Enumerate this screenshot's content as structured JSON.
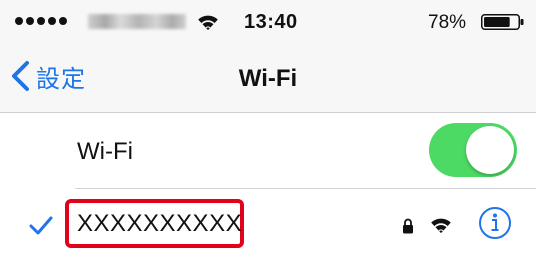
{
  "status_bar": {
    "time": "13:40",
    "battery_percent": "78%",
    "battery_level": 0.78,
    "signal_bars": 5
  },
  "nav": {
    "back_label": "設定",
    "title": "Wi-Fi"
  },
  "wifi_row": {
    "label": "Wi-Fi",
    "toggle_on": true
  },
  "network": {
    "name": "XXXXXXXXXX",
    "selected": true,
    "secured": true
  },
  "colors": {
    "accent": "#1f74e8",
    "toggle_on": "#4cd964",
    "highlight": "#e3001b"
  }
}
